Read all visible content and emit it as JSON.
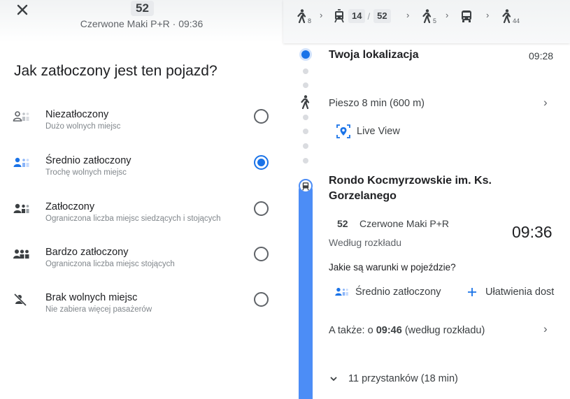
{
  "left": {
    "header": {
      "route": "52",
      "subtitle": "Czerwone Maki P+R · 09:36"
    },
    "question": "Jak zatłoczony jest ten pojazd?",
    "options": [
      {
        "title": "Niezatłoczony",
        "subtitle": "Dużo wolnych miejsc",
        "selected": false
      },
      {
        "title": "Średnio zatłoczony",
        "subtitle": "Trochę wolnych miejsc",
        "selected": true
      },
      {
        "title": "Zatłoczony",
        "subtitle": "Ograniczona liczba miejsc siedzących i stojących",
        "selected": false
      },
      {
        "title": "Bardzo zatłoczony",
        "subtitle": "Ograniczona liczba miejsc stojących",
        "selected": false
      },
      {
        "title": "Brak wolnych miejsc",
        "subtitle": "Nie zabiera więcej pasażerów",
        "selected": false
      }
    ]
  },
  "right": {
    "route_bar": {
      "walk1_min": "8",
      "line_a": "14",
      "line_b": "52",
      "walk2_min": "5",
      "walk3_min": "44"
    },
    "origin": {
      "label": "Twoja lokalizacja",
      "time": "09:28"
    },
    "walk": {
      "label": "Pieszo 8 min (600 m)"
    },
    "live_view": "Live View",
    "stop": {
      "name_line1": "Rondo Kocmyrzowskie im. Ks.",
      "name_line2": "Gorzelanego"
    },
    "departure": {
      "line": "52",
      "destination": "Czerwone Maki P+R",
      "schedule_note": "Według rozkładu",
      "time": "09:36"
    },
    "conditions_question": "Jakie są warunki w pojeździe?",
    "crowd_status": "Średnio zatłoczony",
    "accessibility": "Ułatwienia dost",
    "also": {
      "prefix": "A także: o ",
      "time": "09:46",
      "suffix": " (według rozkładu)"
    },
    "stops_summary": "11 przystanków (18 min)"
  },
  "colors": {
    "accent": "#1a73e8",
    "route_line": "#4c8df6",
    "text_secondary": "#5f6368"
  },
  "icons": [
    "close-icon",
    "walk-icon",
    "tram-icon",
    "bus-icon",
    "people-icon",
    "no-seats-icon",
    "live-view-icon",
    "chevron-right-icon",
    "chevron-down-icon",
    "plus-icon"
  ]
}
